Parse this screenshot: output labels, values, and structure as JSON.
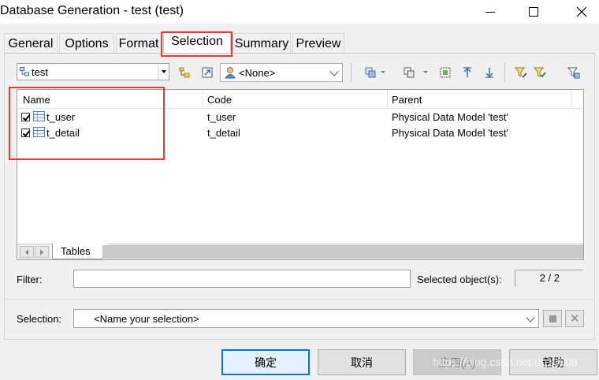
{
  "window": {
    "title": "Database Generation - test (test)"
  },
  "tabs": [
    {
      "label": "General"
    },
    {
      "label": "Options"
    },
    {
      "label": "Format"
    },
    {
      "label": "Selection"
    },
    {
      "label": "Summary"
    },
    {
      "label": "Preview"
    }
  ],
  "active_tab": "Selection",
  "toolbar": {
    "model_value": "test",
    "owner_value": "<None>"
  },
  "list": {
    "columns": [
      "Name",
      "Code",
      "Parent"
    ],
    "rows": [
      {
        "checked": true,
        "name": "t_user",
        "code": "t_user",
        "parent": "Physical Data Model 'test'"
      },
      {
        "checked": true,
        "name": "t_detail",
        "code": "t_detail",
        "parent": "Physical Data Model 'test'"
      }
    ],
    "sheet_tab": "Tables"
  },
  "filter": {
    "label": "Filter:",
    "value": ""
  },
  "selected_objects": {
    "label": "Selected object(s):",
    "count": "2 / 2"
  },
  "selection": {
    "label": "Selection:",
    "value": "<Name your selection>"
  },
  "buttons": {
    "ok": "确定",
    "cancel": "取消",
    "apply": "应用(A)",
    "help": "帮助"
  },
  "watermark": "https://blog.csdn.net/u010908",
  "colors": {
    "highlight": "#e53935",
    "default_button_border": "#0078d7"
  }
}
